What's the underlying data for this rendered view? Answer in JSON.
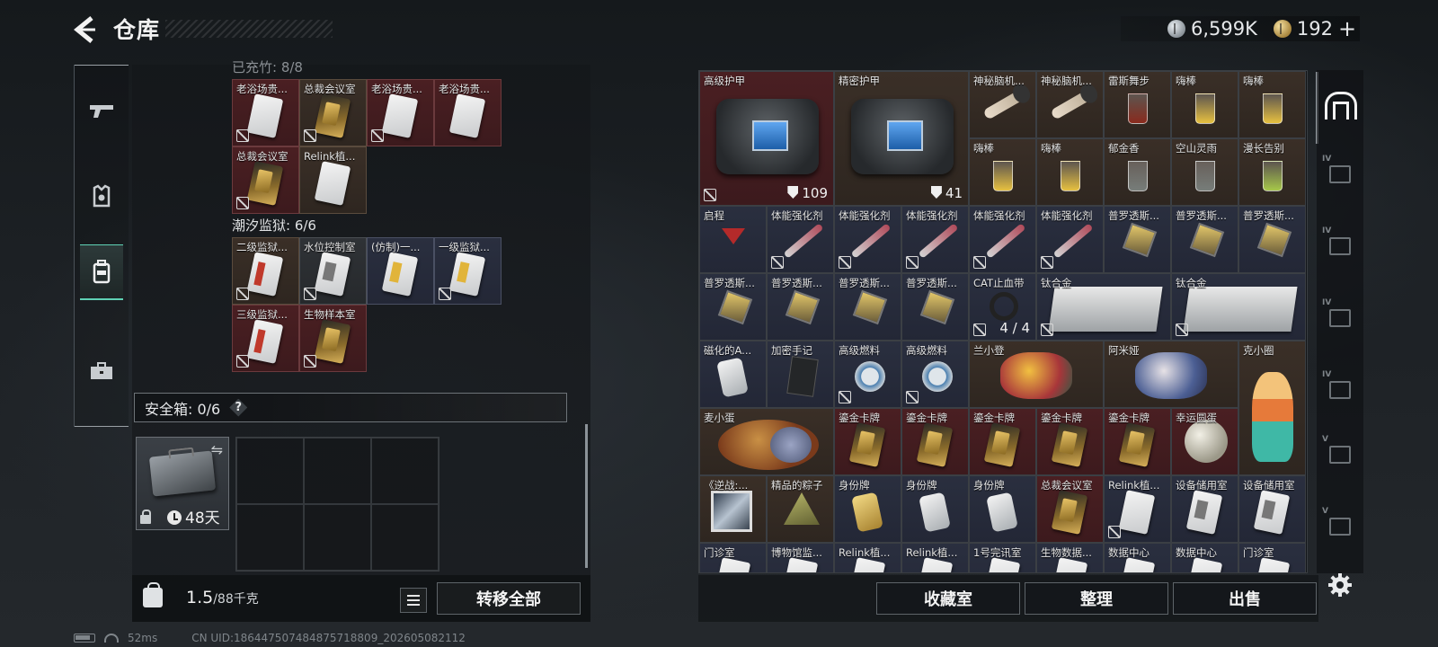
{
  "header": {
    "title": "仓库",
    "silver_amount": "6,599K",
    "gold_amount": "192",
    "plus": "+"
  },
  "left_panel": {
    "category_faded": "已充竹: 8/8",
    "group1": [
      {
        "name": "老浴场贵...",
        "bg": "red",
        "art": "card",
        "nolink": true
      },
      {
        "name": "总裁会议室",
        "bg": "brown",
        "art": "card gold",
        "nolink": true
      },
      {
        "name": "老浴场贵...",
        "bg": "red",
        "art": "card",
        "nolink": true
      },
      {
        "name": "老浴场贵...",
        "bg": "red",
        "art": "card",
        "nolink": false
      },
      {
        "name": "总裁会议室",
        "bg": "red",
        "art": "card gold",
        "nolink": true
      },
      {
        "name": "Relink植...",
        "bg": "brown",
        "art": "card",
        "nolink": false
      }
    ],
    "group2_label": "潮汐监狱: 6/6",
    "group2": [
      {
        "name": "二级监狱...",
        "bg": "brown",
        "art": "card red-strip",
        "nolink": true
      },
      {
        "name": "水位控制室",
        "bg": "gray",
        "art": "card gray-strip",
        "nolink": true
      },
      {
        "name": "(仿制)一...",
        "bg": "navy",
        "art": "card yellow-strip",
        "nolink": false
      },
      {
        "name": "一级监狱...",
        "bg": "navy",
        "art": "card yellow-strip",
        "nolink": true
      },
      {
        "name": "三级监狱...",
        "bg": "red",
        "art": "card red-strip",
        "nolink": true
      },
      {
        "name": "生物样本室",
        "bg": "red",
        "art": "card gold",
        "nolink": true
      }
    ],
    "safe_label": "安全箱: 0/6",
    "safe_help": "?",
    "safe_days": "48天",
    "weight_current": "1.5",
    "weight_max": "/88千克",
    "transfer_all": "转移全部"
  },
  "right_grid": [
    {
      "name": "高级护甲",
      "bg": "red",
      "art": "bag-art",
      "span": "span2x2",
      "count": "109",
      "shield": true,
      "nolink": true
    },
    {
      "name": "精密护甲",
      "bg": "brown",
      "art": "bag-art",
      "span": "span2x2",
      "count": "41",
      "shield": true,
      "nolink": false
    },
    {
      "name": "神秘脑机...",
      "bg": "brown",
      "art": "band"
    },
    {
      "name": "神秘脑机...",
      "bg": "brown",
      "art": "band"
    },
    {
      "name": "雷斯舞步",
      "bg": "brown",
      "art": "drink red"
    },
    {
      "name": "嗨棒",
      "bg": "brown",
      "art": "drink"
    },
    {
      "name": "嗨棒",
      "bg": "brown",
      "art": "drink"
    },
    {
      "name": "嗨棒",
      "bg": "brown",
      "art": "drink"
    },
    {
      "name": "嗨棒",
      "bg": "brown",
      "art": "drink"
    },
    {
      "name": "郁金香",
      "bg": "brown",
      "art": "drink clear"
    },
    {
      "name": "空山灵雨",
      "bg": "brown",
      "art": "drink clear"
    },
    {
      "name": "漫长告别",
      "bg": "brown",
      "art": "drink green"
    },
    {
      "name": "启程",
      "bg": "navy",
      "art": "cocktail"
    },
    {
      "name": "体能强化剂",
      "bg": "navy",
      "art": "syringe",
      "nolink": true
    },
    {
      "name": "体能强化剂",
      "bg": "navy",
      "art": "syringe",
      "nolink": true
    },
    {
      "name": "体能强化剂",
      "bg": "navy",
      "art": "syringe",
      "nolink": true
    },
    {
      "name": "体能强化剂",
      "bg": "navy",
      "art": "syringe",
      "nolink": true
    },
    {
      "name": "体能强化剂",
      "bg": "navy",
      "art": "syringe",
      "nolink": true
    },
    {
      "name": "普罗透斯...",
      "bg": "navy",
      "art": "chip"
    },
    {
      "name": "普罗透斯...",
      "bg": "navy",
      "art": "chip"
    },
    {
      "name": "普罗透斯...",
      "bg": "navy",
      "art": "chip"
    },
    {
      "name": "普罗透斯...",
      "bg": "navy",
      "art": "chip"
    },
    {
      "name": "普罗透斯...",
      "bg": "navy",
      "art": "chip"
    },
    {
      "name": "普罗透斯...",
      "bg": "navy",
      "art": "chip"
    },
    {
      "name": "普罗透斯...",
      "bg": "navy",
      "art": "chip"
    },
    {
      "name": "CAT止血带",
      "bg": "navy",
      "art": "tourniquet",
      "count": "4 / 4",
      "nolink": true
    },
    {
      "name": "钛合金",
      "bg": "navy",
      "art": "metal",
      "span": "span2",
      "nolink": true
    },
    {
      "name": "钛合金",
      "bg": "navy",
      "art": "metal",
      "span": "span2",
      "nolink": true
    },
    {
      "name": "磁化的A...",
      "bg": "navy",
      "art": "tag"
    },
    {
      "name": "加密手记",
      "bg": "navy",
      "art": "notebook"
    },
    {
      "name": "高级燃料",
      "bg": "navy",
      "art": "can",
      "nolink": true
    },
    {
      "name": "高级燃料",
      "bg": "navy",
      "art": "can",
      "nolink": true
    },
    {
      "name": "兰小登",
      "bg": "brown",
      "art": "toy",
      "span": "span2"
    },
    {
      "name": "阿米娅",
      "bg": "brown",
      "art": "toy blue",
      "span": "span2"
    },
    {
      "name": "克小圈",
      "bg": "brown",
      "art": "doll",
      "tall": true
    },
    {
      "name": "麦小蛋",
      "bg": "brown",
      "art": "egg",
      "span": "span2"
    },
    {
      "name": "鎏金卡牌",
      "bg": "red",
      "art": "card gold"
    },
    {
      "name": "鎏金卡牌",
      "bg": "red",
      "art": "card gold"
    },
    {
      "name": "鎏金卡牌",
      "bg": "red",
      "art": "card gold"
    },
    {
      "name": "鎏金卡牌",
      "bg": "red",
      "art": "card gold"
    },
    {
      "name": "鎏金卡牌",
      "bg": "red",
      "art": "card gold"
    },
    {
      "name": "幸运圆蛋",
      "bg": "red",
      "art": "moon"
    },
    {
      "name": "《逆战:...",
      "bg": "brown",
      "art": "photo"
    },
    {
      "name": "精品的粽子",
      "bg": "brown",
      "art": "zongzi"
    },
    {
      "name": "身份牌",
      "bg": "navy",
      "art": "tag gold"
    },
    {
      "name": "身份牌",
      "bg": "navy",
      "art": "tag"
    },
    {
      "name": "身份牌",
      "bg": "navy",
      "art": "tag"
    },
    {
      "name": "总裁会议室",
      "bg": "red",
      "art": "card gold"
    },
    {
      "name": "Relink植...",
      "bg": "navy",
      "art": "card",
      "nolink": true
    },
    {
      "name": "设备储用室",
      "bg": "navy",
      "art": "card gray-strip"
    },
    {
      "name": "设备储用室",
      "bg": "navy",
      "art": "card gray-strip"
    },
    {
      "name": "门诊室",
      "bg": "navy",
      "art": "card"
    },
    {
      "name": "博物馆监...",
      "bg": "navy",
      "art": "card"
    },
    {
      "name": "Relink植...",
      "bg": "navy",
      "art": "card"
    },
    {
      "name": "Relink植...",
      "bg": "navy",
      "art": "card"
    },
    {
      "name": "1号完讯室",
      "bg": "navy",
      "art": "card"
    },
    {
      "name": "生物数据...",
      "bg": "navy",
      "art": "card"
    },
    {
      "name": "数据中心",
      "bg": "navy",
      "art": "card"
    },
    {
      "name": "数据中心",
      "bg": "navy",
      "art": "card"
    },
    {
      "name": "门诊室",
      "bg": "navy",
      "art": "card"
    }
  ],
  "right_buttons": {
    "collection": "收藏室",
    "organize": "整理",
    "sell": "出售"
  },
  "status": {
    "ping": "52ms",
    "uid": "CN UID:1864475074848757188​09_202605082112"
  },
  "colors": {
    "accent": "#5fd1b4",
    "red_cell": "#4a1f22",
    "brown_cell": "#3a2f27",
    "navy_cell": "#2a2f3f"
  }
}
